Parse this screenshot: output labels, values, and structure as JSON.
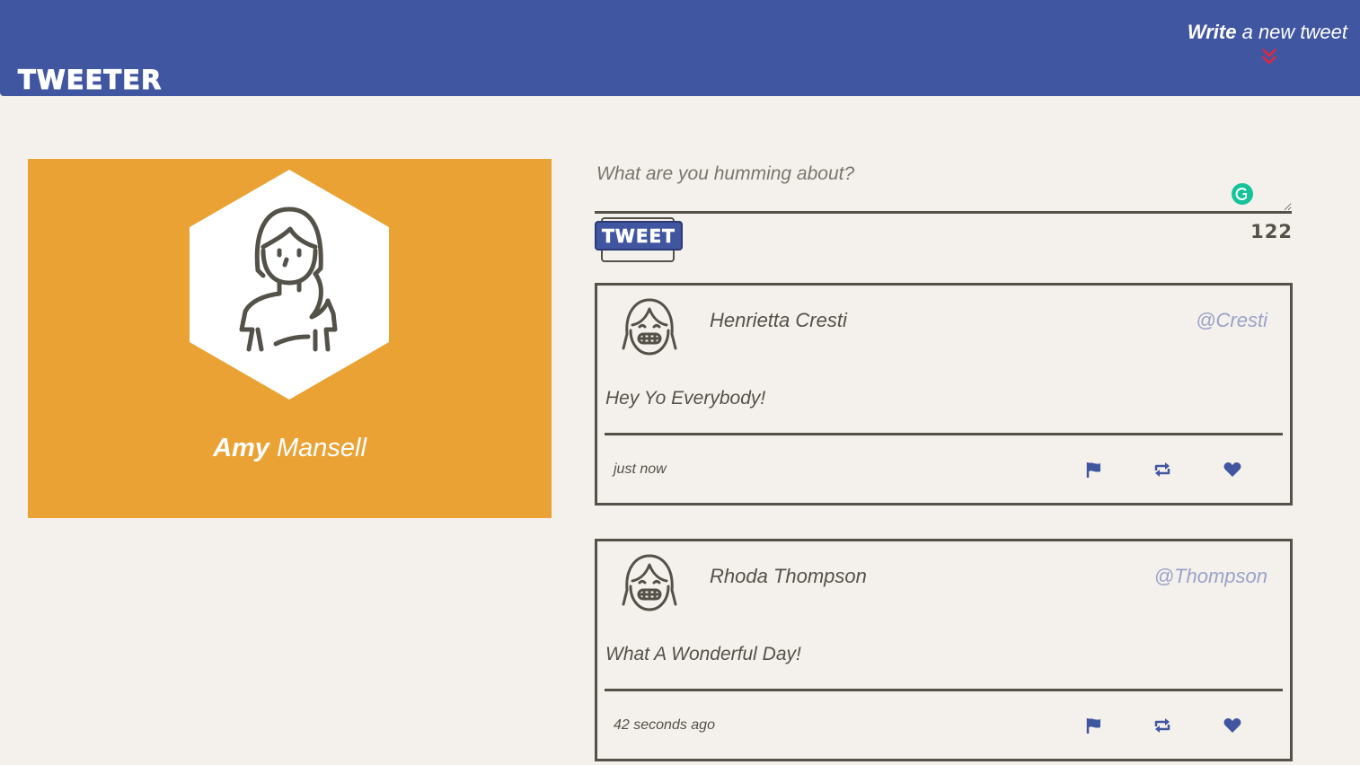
{
  "nav": {
    "brand": "TWEETER",
    "compose_bold": "Write",
    "compose_rest": " a new tweet",
    "toggle_icon": "double-chevron-down-icon",
    "toggle_color": "#e8253b",
    "bg_color": "#4056a1"
  },
  "profile": {
    "first_name": "Amy",
    "last_name": " Mansell",
    "bg_color": "#eba235",
    "avatar_icon": "woman-avatar-icon"
  },
  "composer": {
    "placeholder": "What are you humming about?",
    "button_label": "TWEET",
    "counter": "122"
  },
  "tweets": [
    {
      "author": "Henrietta Cresti",
      "handle": "@Cresti",
      "body": "Hey Yo Everybody!",
      "time": "just now",
      "avatar_icon": "smiling-girl-avatar-icon"
    },
    {
      "author": "Rhoda Thompson",
      "handle": "@Thompson",
      "body": "What A Wonderful Day!",
      "time": "42 seconds ago",
      "avatar_icon": "smiling-girl-avatar-icon"
    }
  ],
  "actions": {
    "flag_icon": "flag-icon",
    "retweet_icon": "retweet-icon",
    "like_icon": "heart-icon",
    "accent_color": "#4056a1"
  }
}
